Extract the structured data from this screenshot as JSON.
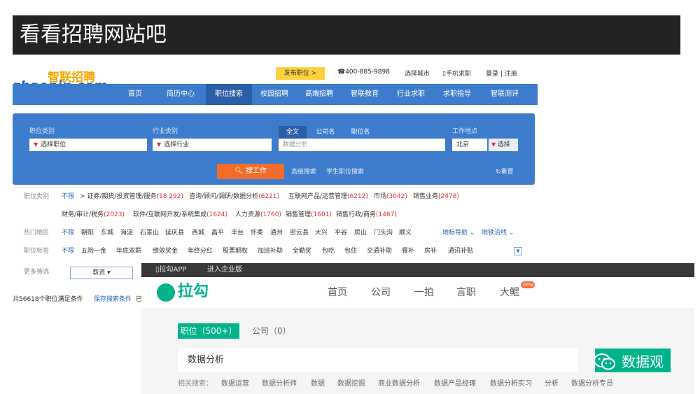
{
  "slide": {
    "title": "看看招聘网站吧"
  },
  "zhaopin": {
    "logo_cn": "智联招聘",
    "logo_en": "zhaopin.com",
    "publish_button": "发布职位 >",
    "phone": "☎400-885-9898",
    "choose_city": "选择城市",
    "mobile_search": "▯手机求职",
    "login": "登录 | 注册",
    "nav": [
      "首页",
      "简历中心",
      "职位搜索",
      "校园招聘",
      "高端招聘",
      "智联教育",
      "行业求职",
      "求职指导",
      "智联测评"
    ],
    "nav_active": 2,
    "search": {
      "job_type_label": "职位类别",
      "job_type_value": "选择职位",
      "industry_label": "行业类别",
      "industry_value": "选择行业",
      "tabs": [
        "全文",
        "公司名",
        "职位名"
      ],
      "keyword_placeholder": "数据分析",
      "location_label": "工作地点",
      "location_value": "北京",
      "choose": "选择",
      "search_button": "搜工作",
      "advanced": "高级搜索",
      "student": "学生职位搜索",
      "reset": "重置"
    },
    "filters": {
      "job_type": {
        "label": "职位类别",
        "unlimited": "不限",
        "row1": [
          {
            "text": "> 证券/期货/投资管理/服务",
            "count": "(18 292)"
          },
          {
            "text": "咨询/顾问/调研/数据分析",
            "count": "(6221)"
          },
          {
            "text": "互联网产品/运营管理",
            "count": "(6212)"
          },
          {
            "text": "市场",
            "count": "(3042)"
          },
          {
            "text": "销售业务",
            "count": "(2478)"
          }
        ],
        "row2": [
          {
            "text": "财务/审计/税务",
            "count": "(2023)"
          },
          {
            "text": "软件/互联网开发/系统集成",
            "count": "(1624)"
          },
          {
            "text": "人力资源",
            "count": "(1760)"
          },
          {
            "text": "销售管理",
            "count": "(1601)"
          },
          {
            "text": "销售行政/商务",
            "count": "(1467)"
          }
        ]
      },
      "hot_areas": {
        "label": "热门地区",
        "unlimited": "不限",
        "items": [
          "朝阳",
          "东城",
          "海淀",
          "石景山",
          "延庆县",
          "西城",
          "昌平",
          "丰台",
          "怀柔",
          "通州",
          "密云县",
          "大兴",
          "平谷",
          "房山",
          "门头沟",
          "顺义"
        ],
        "metro_search": "地标导航 ⌄",
        "subway": "地铁沿线 ⌄"
      },
      "benefits": {
        "label": "职位标签",
        "unlimited": "不限",
        "items": [
          "五险一金",
          "年底双薪",
          "绩效奖金",
          "年终分红",
          "股票期权",
          "加班补助",
          "全勤奖",
          "包吃",
          "包住",
          "交通补助",
          "餐补",
          "房补",
          "通讯补贴"
        ]
      },
      "more": {
        "label": "更多筛选",
        "salary": "薪资 ▾"
      }
    },
    "footer": {
      "count_text": "共56618个职位满足条件",
      "save": "保存搜索条件",
      "already": "已"
    }
  },
  "lagou": {
    "app": "▯拉勾APP",
    "enterprise": "进入企业版",
    "logo": "拉勾",
    "nav": [
      "首页",
      "公司",
      "一拍",
      "言职",
      "大鲲"
    ],
    "new_badge": "new",
    "tab_active": "职位（500+）",
    "tab_company": "公司（0）",
    "search_value": "数据分析",
    "related_label": "相关搜索：",
    "related": [
      "数据运营",
      "数据分析师",
      "数据",
      "数据挖掘",
      "商业数据分析",
      "数据产品经理",
      "数据分析实习",
      "分析",
      "数据分析专员"
    ]
  },
  "watermark": {
    "text": "数据观"
  },
  "colors": {
    "zhaopin_blue": "#3d7ccc",
    "zhaopin_orange": "#f36d2a",
    "lagou_green": "#00b38a",
    "title_bar": "#232323"
  }
}
